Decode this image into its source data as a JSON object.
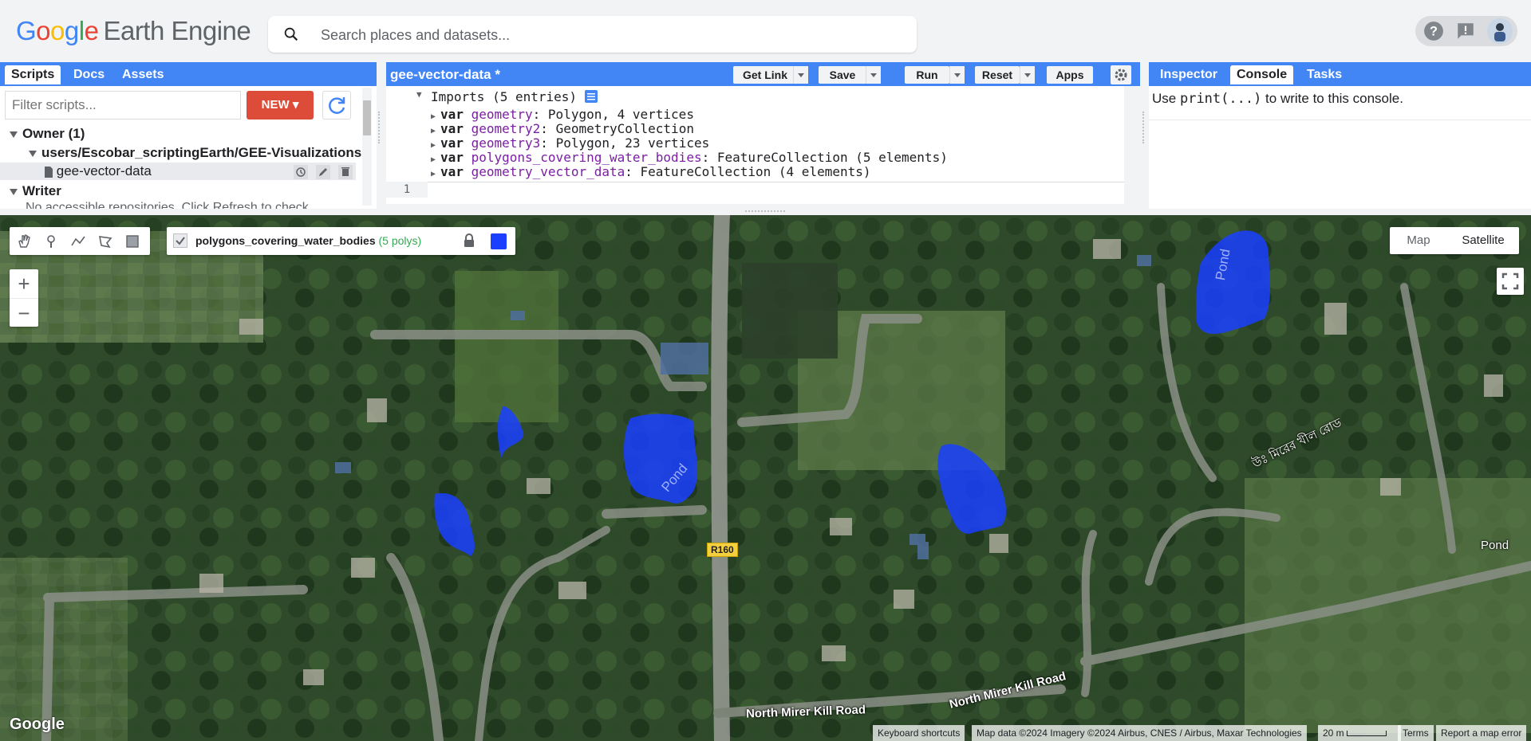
{
  "header": {
    "logo_google": [
      "G",
      "o",
      "o",
      "g",
      "l",
      "e"
    ],
    "logo_rest": "Earth Engine",
    "search_placeholder": "Search places and datasets...",
    "icons": [
      "help-icon",
      "feedback-icon",
      "account-avatar"
    ]
  },
  "left_panel": {
    "tabs": [
      "Scripts",
      "Docs",
      "Assets"
    ],
    "active_tab": "Scripts",
    "filter_placeholder": "Filter scripts...",
    "new_label": "NEW",
    "tree": {
      "owner": "Owner (1)",
      "repo": "users/Escobar_scriptingEarth/GEE-Visualizations",
      "file": "gee-vector-data",
      "writer": "Writer",
      "writer_note": "No accessible repositories. Click Refresh to check"
    }
  },
  "code_panel": {
    "title": "gee-vector-data *",
    "buttons": {
      "get_link": "Get Link",
      "save": "Save",
      "run": "Run",
      "reset": "Reset",
      "apps": "Apps"
    },
    "imports_header": "Imports (5 entries)",
    "imports": [
      {
        "kw": "var",
        "name": "geometry",
        "desc": ": Polygon, 4 vertices"
      },
      {
        "kw": "var",
        "name": "geometry2",
        "desc": ": GeometryCollection"
      },
      {
        "kw": "var",
        "name": "geometry3",
        "desc": ": Polygon, 23 vertices"
      },
      {
        "kw": "var",
        "name": "polygons_covering_water_bodies",
        "desc": ": FeatureCollection (5 elements)"
      },
      {
        "kw": "var",
        "name": "geometry_vector_data",
        "desc": ": FeatureCollection (4 elements)"
      }
    ],
    "line_number": "1"
  },
  "right_panel": {
    "tabs": [
      "Inspector",
      "Console",
      "Tasks"
    ],
    "active_tab": "Console",
    "msg_pre": "Use ",
    "msg_code": "print(...)",
    "msg_post": " to write to this console."
  },
  "map": {
    "layer_name": "polygons_covering_water_bodies",
    "layer_count": "(5 polys)",
    "layer_color": "#1a3fff",
    "zoom_in": "+",
    "zoom_out": "−",
    "maptype": {
      "map": "Map",
      "satellite": "Satellite",
      "active": "Satellite"
    },
    "road_labels": {
      "r160": "R160",
      "north1": "North Mirer Kill Road",
      "north2": "North Mirer Kill Road",
      "bengali": "উঃ মিরের খীল রোড"
    },
    "pond_label": "Pond",
    "google": "Google",
    "attribution": {
      "shortcuts": "Keyboard shortcuts",
      "data": "Map data ©2024 Imagery ©2024 Airbus, CNES / Airbus, Maxar Technologies",
      "scale": "20 m",
      "terms": "Terms",
      "report": "Report a map error"
    }
  },
  "colors": {
    "accent": "#4285f4",
    "new_button": "#dd4b39",
    "polygon_fill": "#1a3fff"
  }
}
